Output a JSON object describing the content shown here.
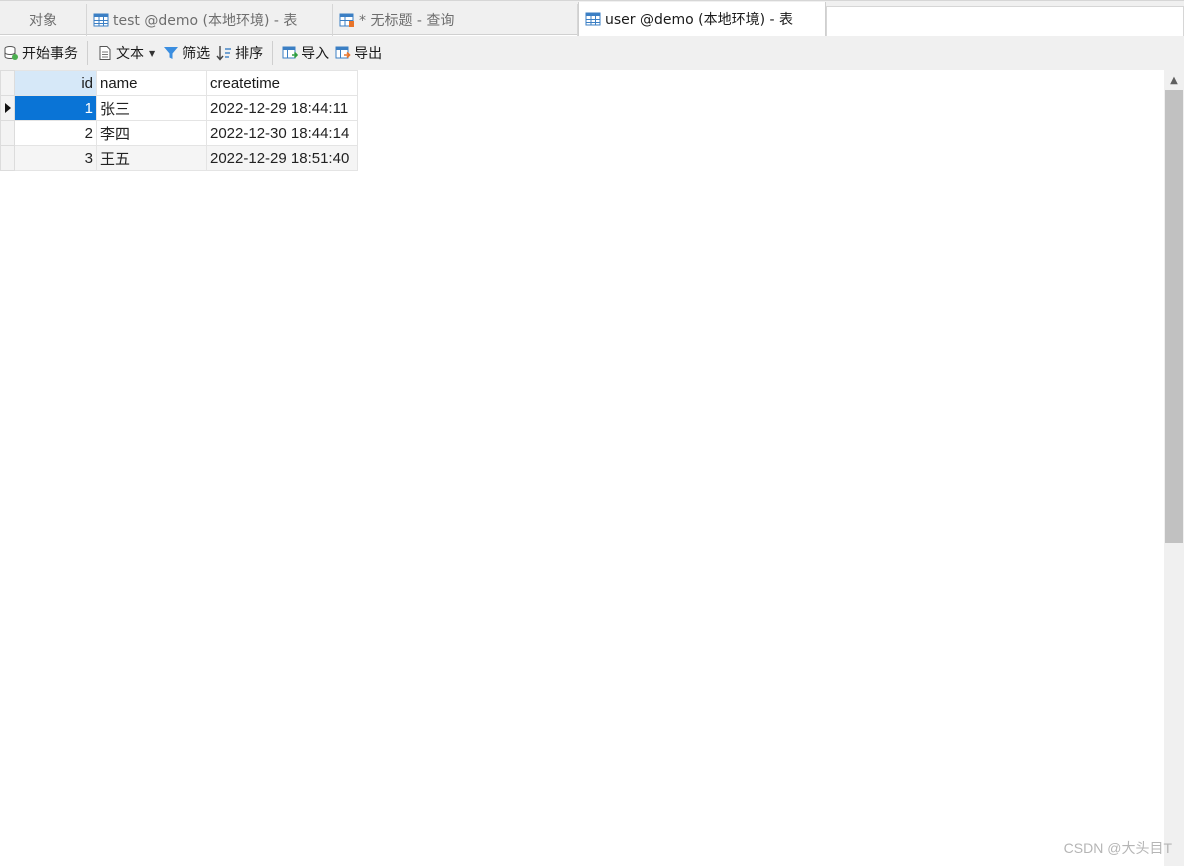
{
  "tabs": {
    "objects": "对象",
    "items": [
      {
        "label": "test @demo (本地环境) - 表",
        "icon": "table-icon"
      },
      {
        "label": "* 无标题 - 查询",
        "icon": "query-icon"
      },
      {
        "label": "user @demo (本地环境) - 表",
        "icon": "table-icon",
        "active": true
      }
    ]
  },
  "toolbar": {
    "begin_transaction": "开始事务",
    "text": "文本",
    "filter": "筛选",
    "sort": "排序",
    "import": "导入",
    "export": "导出"
  },
  "grid": {
    "columns": [
      "id",
      "name",
      "createtime"
    ],
    "rows": [
      {
        "id": "1",
        "name": "张三",
        "createtime": "2022-12-29 18:44:11"
      },
      {
        "id": "2",
        "name": "李四",
        "createtime": "2022-12-30 18:44:14"
      },
      {
        "id": "3",
        "name": "王五",
        "createtime": "2022-12-29 18:51:40"
      }
    ],
    "selected_row": 1
  },
  "colors": {
    "selection": "#0a74d6",
    "header_highlight": "#d6e8f8"
  },
  "watermark": "CSDN @大头目T"
}
